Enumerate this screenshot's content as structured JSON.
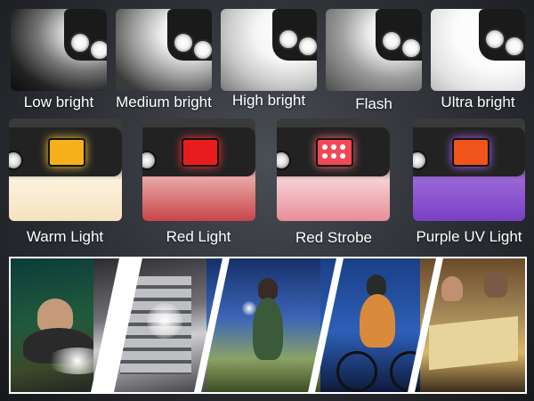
{
  "top_modes": [
    {
      "label": "Low bright"
    },
    {
      "label": "Medium bright"
    },
    {
      "label": "High bright"
    },
    {
      "label": "Flash"
    },
    {
      "label": "Ultra bright"
    }
  ],
  "color_modes": [
    {
      "label": "Warm Light",
      "panel_color": "#f5b01a"
    },
    {
      "label": "Red Light",
      "panel_color": "#e81c1c"
    },
    {
      "label": "Red Strobe",
      "panel_color": "#f24755"
    },
    {
      "label": "Purple UV Light",
      "panel_color": "#f0541a"
    }
  ],
  "scenes": [
    {
      "name": "camping-tent-scene"
    },
    {
      "name": "server-rack-scene"
    },
    {
      "name": "night-hiking-scene"
    },
    {
      "name": "night-cycling-scene"
    },
    {
      "name": "map-reading-scene"
    }
  ],
  "colors": {
    "background": "#2b2e33",
    "label_text": "#ffffff"
  }
}
